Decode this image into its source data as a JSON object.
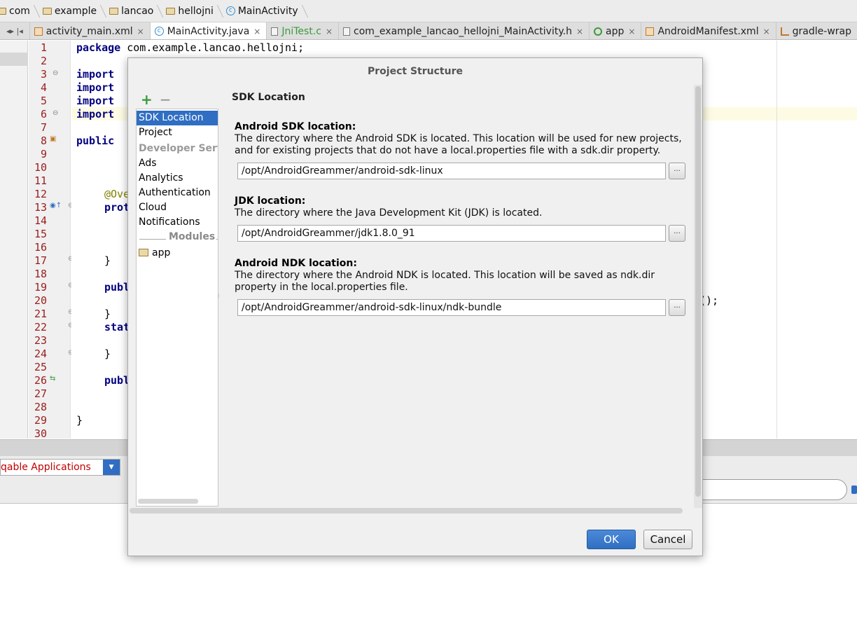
{
  "breadcrumb": {
    "items": [
      {
        "label": "com",
        "icon": "folder-icon"
      },
      {
        "label": "example",
        "icon": "folder-icon"
      },
      {
        "label": "lancao",
        "icon": "folder-icon"
      },
      {
        "label": "hellojni",
        "icon": "folder-icon"
      },
      {
        "label": "MainActivity",
        "icon": "class-icon"
      }
    ]
  },
  "editor_tabs": {
    "items": [
      {
        "label": "activity_main.xml",
        "icon": "xml-file-icon",
        "close": "×"
      },
      {
        "label": "MainActivity.java",
        "icon": "class-icon",
        "close": "×"
      },
      {
        "label": "JniTest.c",
        "icon": "c-file-icon",
        "close": "×"
      },
      {
        "label": "com_example_lancao_hellojni_MainActivity.h",
        "icon": "header-file-icon",
        "close": "×"
      },
      {
        "label": "app",
        "icon": "app-module-icon",
        "close": "×"
      },
      {
        "label": "AndroidManifest.xml",
        "icon": "xml-file-icon",
        "close": "×"
      },
      {
        "label": "gradle-wrap",
        "icon": "gradle-icon"
      }
    ],
    "active_index": 1
  },
  "editor": {
    "line_numbers": [
      "1",
      "2",
      "3",
      "4",
      "5",
      "6",
      "7",
      "8",
      "9",
      "10",
      "11",
      "12",
      "13",
      "14",
      "15",
      "16",
      "17",
      "18",
      "19",
      "20",
      "21",
      "22",
      "23",
      "24",
      "25",
      "26",
      "27",
      "28",
      "29",
      "30"
    ],
    "lines": {
      "l1_kw": "package",
      "l1_rest": " com.example.lancao.hellojni;",
      "l3": "import",
      "l4": "import",
      "l5": "import",
      "l6": "import",
      "l8": "public",
      "l12": "@Ove",
      "l13": "prot",
      "l17": "}",
      "l19": "publ",
      "l20_right": "();",
      "l21": "}",
      "l22": "stat",
      "l24": "}",
      "l26": "publ",
      "l29": "}"
    }
  },
  "logcat": {
    "process_select": "qable Applications"
  },
  "dialog": {
    "title": "Project Structure",
    "add_label": "+",
    "remove_label": "−",
    "nav": {
      "sdk_location": "SDK Location",
      "project": "Project",
      "developer_services": "Developer Serv",
      "ads": "Ads",
      "analytics": "Analytics",
      "authentication": "Authentication",
      "cloud": "Cloud",
      "notifications": "Notifications",
      "modules": "Modules",
      "app": "app"
    },
    "content": {
      "title": "SDK Location",
      "android_sdk": {
        "label": "Android SDK location:",
        "description": "The directory where the Android SDK is located. This location will be used for new projects, and for existing projects that do not have a local.properties file with a sdk.dir property.",
        "value": "/opt/AndroidGreammer/android-sdk-linux",
        "browse": "..."
      },
      "jdk": {
        "label": "JDK location:",
        "description": "The directory where the Java Development Kit (JDK) is located.",
        "value": "/opt/AndroidGreammer/jdk1.8.0_91",
        "browse": "..."
      },
      "android_ndk": {
        "label": "Android NDK location:",
        "description": "The directory where the Android NDK is located. This location will be saved as ndk.dir property in the local.properties file.",
        "value": "/opt/AndroidGreammer/android-sdk-linux/ndk-bundle",
        "browse": "..."
      }
    },
    "ok": "OK",
    "cancel": "Cancel"
  }
}
